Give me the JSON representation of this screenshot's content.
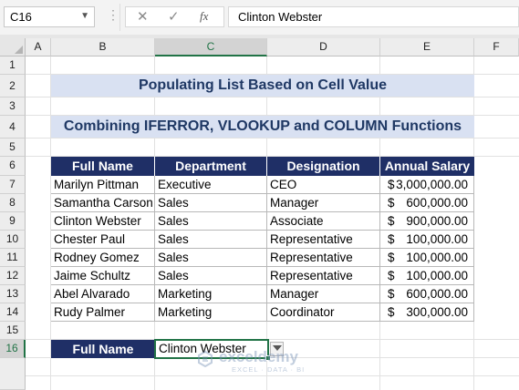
{
  "formula_bar": {
    "name_box": "C16",
    "name_box_icon": "chevron-down-icon",
    "cancel_icon": "✕",
    "enter_icon": "✓",
    "fx_label": "fx",
    "formula": "Clinton Webster"
  },
  "columns": [
    "A",
    "B",
    "C",
    "D",
    "E",
    "F"
  ],
  "rows": [
    "1",
    "2",
    "3",
    "4",
    "5",
    "6",
    "7",
    "8",
    "9",
    "10",
    "11",
    "12",
    "13",
    "14",
    "15",
    "16"
  ],
  "selected_cell": "C16",
  "title1": "Populating List Based on Cell Value",
  "title2": "Combining IFERROR, VLOOKUP and COLUMN Functions",
  "table": {
    "headers": [
      "Full Name",
      "Department",
      "Designation",
      "Annual Salary"
    ],
    "rows": [
      {
        "name": "Marilyn Pittman",
        "dept": "Executive",
        "desig": "CEO",
        "currency": "$",
        "salary": "3,000,000.00"
      },
      {
        "name": "Samantha Carson",
        "dept": "Sales",
        "desig": "Manager",
        "currency": "$",
        "salary": "600,000.00"
      },
      {
        "name": "Clinton Webster",
        "dept": "Sales",
        "desig": "Associate",
        "currency": "$",
        "salary": "900,000.00"
      },
      {
        "name": "Chester Paul",
        "dept": "Sales",
        "desig": "Representative",
        "currency": "$",
        "salary": "100,000.00"
      },
      {
        "name": "Rodney Gomez",
        "dept": "Sales",
        "desig": "Representative",
        "currency": "$",
        "salary": "100,000.00"
      },
      {
        "name": "Jaime Schultz",
        "dept": "Sales",
        "desig": "Representative",
        "currency": "$",
        "salary": "100,000.00"
      },
      {
        "name": "Abel Alvarado",
        "dept": "Marketing",
        "desig": "Manager",
        "currency": "$",
        "salary": "600,000.00"
      },
      {
        "name": "Rudy Palmer",
        "dept": "Marketing",
        "desig": "Coordinator",
        "currency": "$",
        "salary": "300,000.00"
      }
    ]
  },
  "lookup": {
    "label": "Full Name",
    "value": "Clinton Webster",
    "dropdown_icon": "dropdown-arrow-icon"
  },
  "watermark": {
    "name": "exceldemy",
    "tagline": "EXCEL · DATA · BI"
  },
  "colors": {
    "header_navy": "#1f2f66",
    "title_band": "#d9e1f2",
    "title_text": "#1f3864",
    "excel_green": "#217346"
  }
}
